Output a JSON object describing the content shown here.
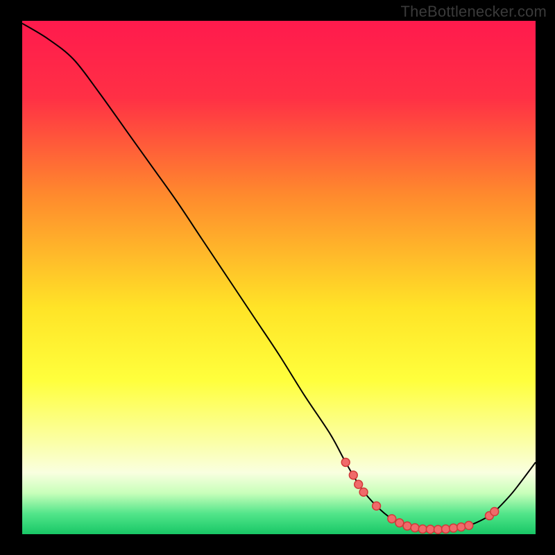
{
  "watermark": "TheBottlenecker.com",
  "chart_data": {
    "type": "line",
    "title": "",
    "xlabel": "",
    "ylabel": "",
    "xlim": [
      0,
      100
    ],
    "ylim": [
      0,
      100
    ],
    "grid": false,
    "background_gradient": {
      "stops": [
        {
          "offset": 0,
          "color": "#ff1a4d"
        },
        {
          "offset": 15,
          "color": "#ff3045"
        },
        {
          "offset": 34,
          "color": "#ff8a2d"
        },
        {
          "offset": 56,
          "color": "#ffe427"
        },
        {
          "offset": 70,
          "color": "#ffff3c"
        },
        {
          "offset": 82,
          "color": "#fbffa6"
        },
        {
          "offset": 88,
          "color": "#f9ffe0"
        },
        {
          "offset": 92,
          "color": "#c8ffba"
        },
        {
          "offset": 96,
          "color": "#52e58a"
        },
        {
          "offset": 100,
          "color": "#18c766"
        }
      ]
    },
    "curve": {
      "stroke": "#000000",
      "points": [
        {
          "x": 0,
          "y": 99.5
        },
        {
          "x": 5,
          "y": 96.5
        },
        {
          "x": 10,
          "y": 92.5
        },
        {
          "x": 15,
          "y": 86
        },
        {
          "x": 20,
          "y": 79
        },
        {
          "x": 25,
          "y": 72
        },
        {
          "x": 30,
          "y": 65
        },
        {
          "x": 35,
          "y": 57.5
        },
        {
          "x": 40,
          "y": 50
        },
        {
          "x": 45,
          "y": 42.5
        },
        {
          "x": 50,
          "y": 35
        },
        {
          "x": 55,
          "y": 27
        },
        {
          "x": 60,
          "y": 19.5
        },
        {
          "x": 63,
          "y": 14
        },
        {
          "x": 66,
          "y": 9
        },
        {
          "x": 69,
          "y": 5.5
        },
        {
          "x": 72,
          "y": 3
        },
        {
          "x": 75,
          "y": 1.6
        },
        {
          "x": 78,
          "y": 1
        },
        {
          "x": 81,
          "y": 0.9
        },
        {
          "x": 84,
          "y": 1.2
        },
        {
          "x": 87,
          "y": 1.7
        },
        {
          "x": 90,
          "y": 3
        },
        {
          "x": 92,
          "y": 4.4
        },
        {
          "x": 95,
          "y": 7.5
        },
        {
          "x": 97,
          "y": 10
        },
        {
          "x": 100,
          "y": 14
        }
      ]
    },
    "markers": {
      "stroke": "#d13a3a",
      "fill": "#f06a6a",
      "radius_data": 0.8,
      "points": [
        {
          "x": 63,
          "y": 14
        },
        {
          "x": 64.5,
          "y": 11.5
        },
        {
          "x": 65.5,
          "y": 9.7
        },
        {
          "x": 66.5,
          "y": 8.2
        },
        {
          "x": 69,
          "y": 5.5
        },
        {
          "x": 72,
          "y": 3
        },
        {
          "x": 73.5,
          "y": 2.2
        },
        {
          "x": 75,
          "y": 1.6
        },
        {
          "x": 76.5,
          "y": 1.25
        },
        {
          "x": 78,
          "y": 1
        },
        {
          "x": 79.5,
          "y": 0.95
        },
        {
          "x": 81,
          "y": 0.9
        },
        {
          "x": 82.5,
          "y": 1.0
        },
        {
          "x": 84,
          "y": 1.2
        },
        {
          "x": 85.5,
          "y": 1.4
        },
        {
          "x": 87,
          "y": 1.7
        },
        {
          "x": 91,
          "y": 3.6
        },
        {
          "x": 92,
          "y": 4.4
        }
      ]
    }
  }
}
